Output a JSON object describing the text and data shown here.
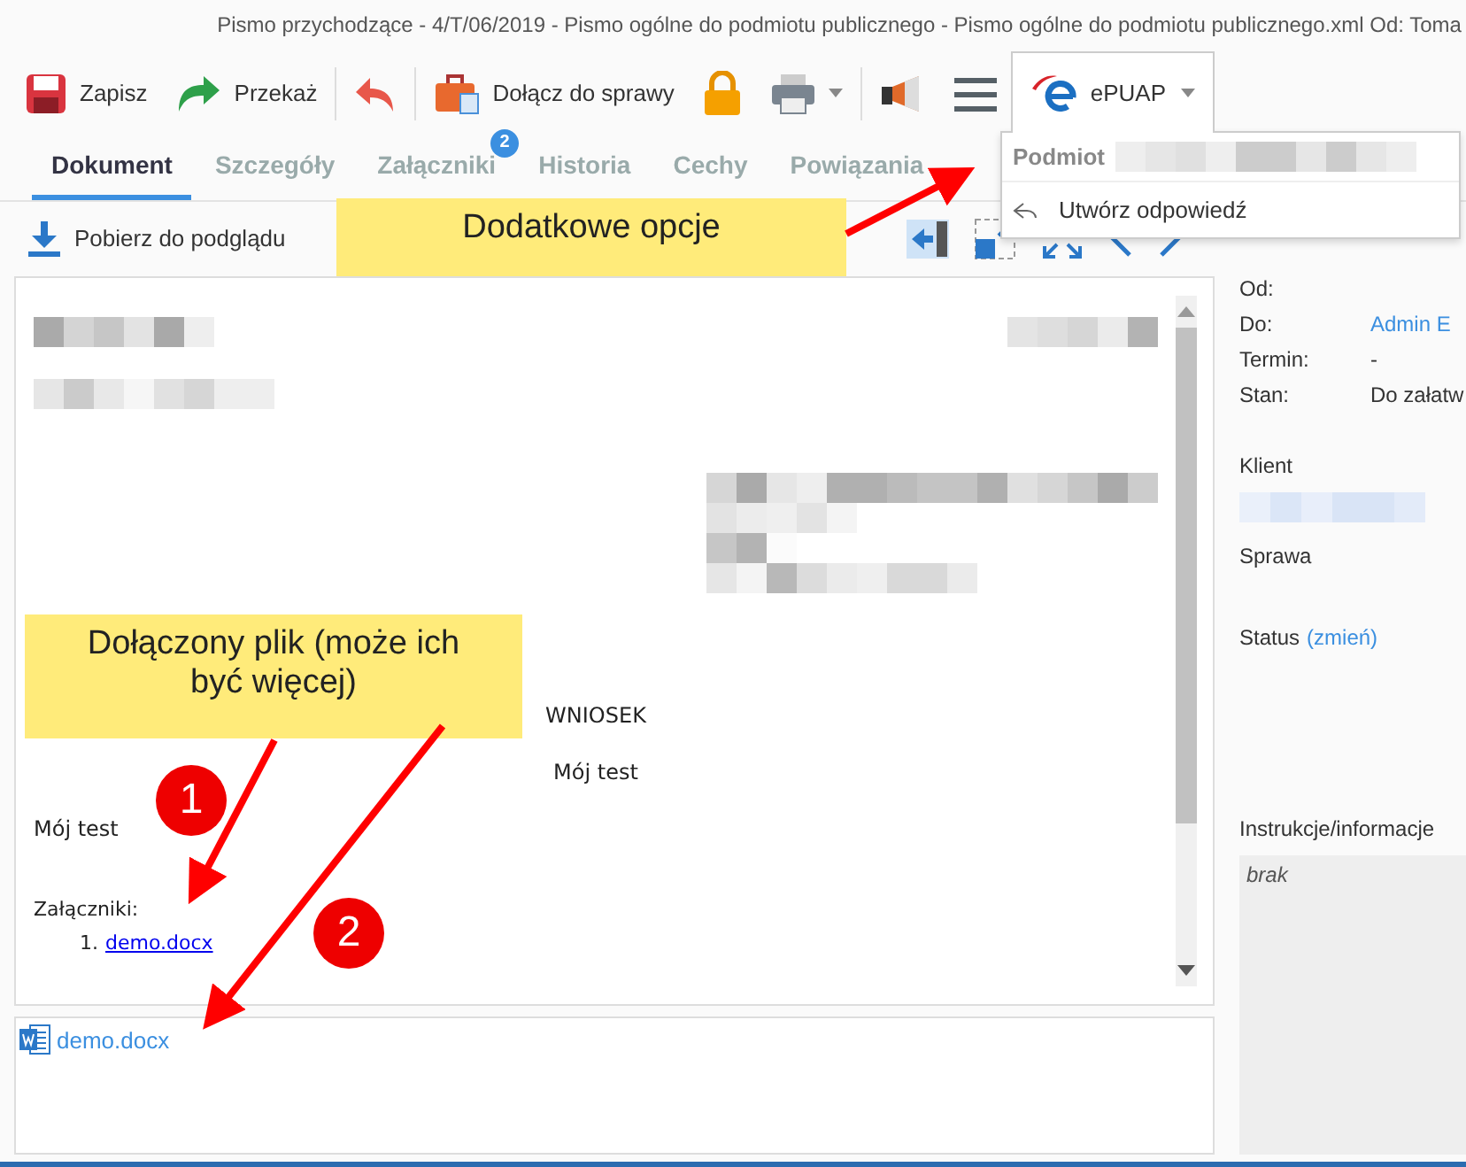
{
  "window": {
    "title": "Pismo przychodzące - 4/T/06/2019 - Pismo ogólne do podmiotu publicznego - Pismo ogólne do podmiotu publicznego.xml Od: Toma"
  },
  "toolbar": [
    {
      "kind": "save",
      "label": "Zapisz"
    },
    {
      "kind": "forward",
      "label": "Przekaż"
    },
    {
      "kind": "undo"
    },
    {
      "kind": "attach",
      "label": "Dołącz do sprawy"
    },
    {
      "kind": "lock"
    },
    {
      "kind": "print"
    },
    {
      "kind": "announce"
    },
    {
      "kind": "menu"
    },
    {
      "kind": "epuap",
      "label": "ePUAP",
      "expanded": true
    }
  ],
  "tabs": [
    {
      "label": "Dokument",
      "selected": true
    },
    {
      "label": "Szczegóły",
      "selected": false
    },
    {
      "label": "Załączniki",
      "selected": false,
      "badge": "2"
    },
    {
      "label": "Historia",
      "selected": false
    },
    {
      "label": "Cechy",
      "selected": false
    },
    {
      "label": "Powiązania",
      "selected": false
    }
  ],
  "epuap_menu": {
    "header_label": "Podmiot",
    "items": [
      {
        "label": "Utwórz odpowiedź"
      }
    ]
  },
  "actions_bar": {
    "download_label": "Pobierz do podglądu"
  },
  "document": {
    "heading": "WNIOSEK",
    "subtitle": "Mój test",
    "body": "Mój test",
    "attachments_label": "Załączniki:",
    "attachments": [
      {
        "number": "1.",
        "name": "demo.docx"
      }
    ]
  },
  "attachment_files": [
    {
      "name": "demo.docx"
    }
  ],
  "details": {
    "fields": [
      {
        "label": "Od:"
      },
      {
        "label": "Do:",
        "value": "Admin E",
        "kind": "link"
      },
      {
        "label": "Termin:",
        "value": "-",
        "kind": "text"
      },
      {
        "label": "Stan:",
        "value": "Do załatw",
        "kind": "text"
      }
    ],
    "client_label": "Klient",
    "case_label": "Sprawa",
    "status_label": "Status",
    "status_link": "(zmień)",
    "instructions_label": "Instrukcje/informacje",
    "instructions": "brak"
  },
  "annotations": {
    "callouts": [
      {
        "text": "Dodatkowe opcje"
      },
      {
        "text": "Dołączony plik (może ich być więcej)"
      }
    ],
    "markers": [
      {
        "number": "1"
      },
      {
        "number": "2"
      }
    ]
  }
}
